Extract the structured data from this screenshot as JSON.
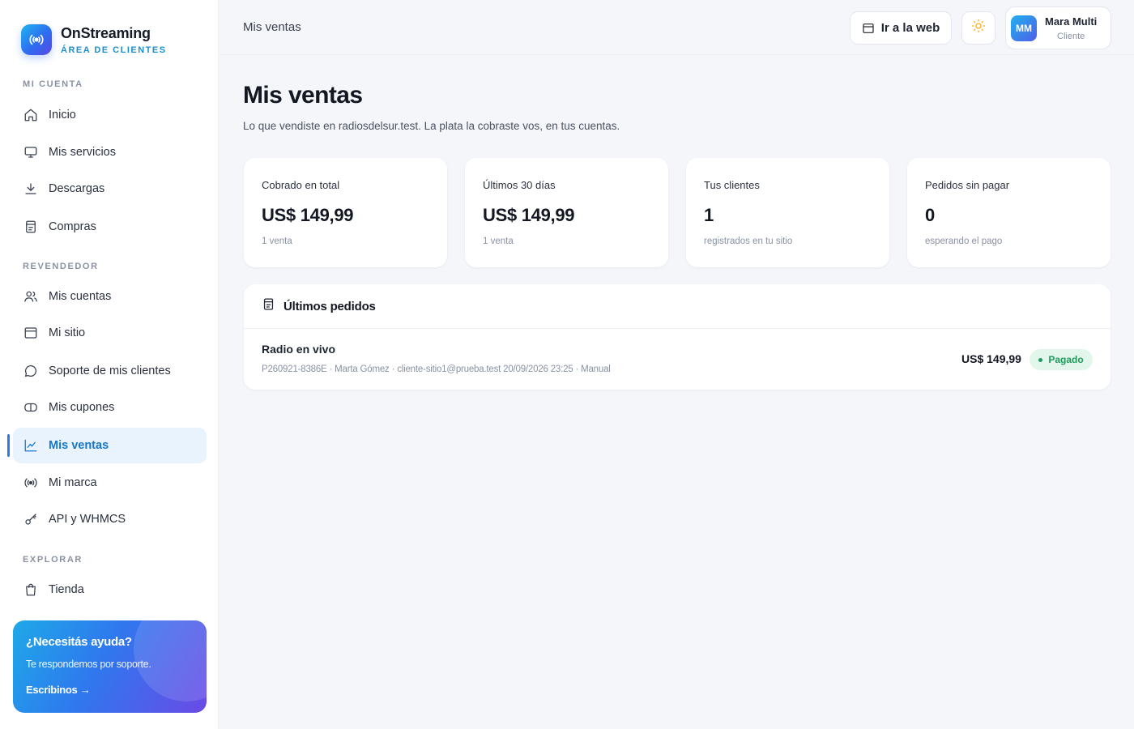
{
  "brand": {
    "name": "OnStreaming",
    "subtitle": "ÁREA DE CLIENTES",
    "logo_icon": "broadcast-icon"
  },
  "sidebar": {
    "sections": [
      {
        "title": "MI CUENTA",
        "items": [
          {
            "label": "Inicio",
            "icon": "home-icon"
          },
          {
            "label": "Mis servicios",
            "icon": "monitor-icon"
          },
          {
            "label": "Descargas",
            "icon": "download-icon"
          },
          {
            "label": "Compras",
            "icon": "receipt-icon"
          }
        ]
      },
      {
        "title": "REVENDEDOR",
        "items": [
          {
            "label": "Mis cuentas",
            "icon": "users-icon"
          },
          {
            "label": "Mi sitio",
            "icon": "browser-icon"
          },
          {
            "label": "Soporte de mis clientes",
            "icon": "chat-icon"
          },
          {
            "label": "Mis cupones",
            "icon": "ticket-icon"
          },
          {
            "label": "Mis ventas",
            "icon": "chart-line-icon",
            "active": true
          },
          {
            "label": "Mi marca",
            "icon": "broadcast-icon"
          },
          {
            "label": "API y WHMCS",
            "icon": "key-icon"
          }
        ]
      },
      {
        "title": "EXPLORAR",
        "items": [
          {
            "label": "Tienda",
            "icon": "shopping-bag-icon"
          }
        ]
      }
    ],
    "help": {
      "title": "¿Necesitás ayuda?",
      "text": "Te respondemos por soporte.",
      "link": "Escribinos →"
    }
  },
  "header": {
    "breadcrumb": "Mis ventas",
    "web_button": "Ir a la web",
    "theme_icon": "sun-icon",
    "user": {
      "initials": "MM",
      "name": "Mara Multi",
      "role": "Cliente"
    }
  },
  "main": {
    "title": "Mis ventas",
    "subtitle": "Lo que vendiste en radiosdelsur.test. La plata la cobraste vos, en tus cuentas.",
    "stats": [
      {
        "label": "Cobrado en total",
        "value": "US$ 149,99",
        "note": "1 venta"
      },
      {
        "label": "Últimos 30 días",
        "value": "US$ 149,99",
        "note": "1 venta"
      },
      {
        "label": "Tus clientes",
        "value": "1",
        "note": "registrados en tu sitio"
      },
      {
        "label": "Pedidos sin pagar",
        "value": "0",
        "note": "esperando el pago"
      }
    ],
    "orders": {
      "title": "Últimos pedidos",
      "rows": [
        {
          "title": "Radio en vivo",
          "meta": "P260921-8386E · Marta Gómez · cliente-sitio1@prueba.test 20/09/2026 23:25 · Manual",
          "amount": "US$ 149,99",
          "status": "Pagado"
        }
      ]
    }
  },
  "colors": {
    "accent": "#1677c9",
    "active_bg": "#e9f3fd",
    "paid_green": "#1f9a5a",
    "sun": "#f2b01e"
  }
}
